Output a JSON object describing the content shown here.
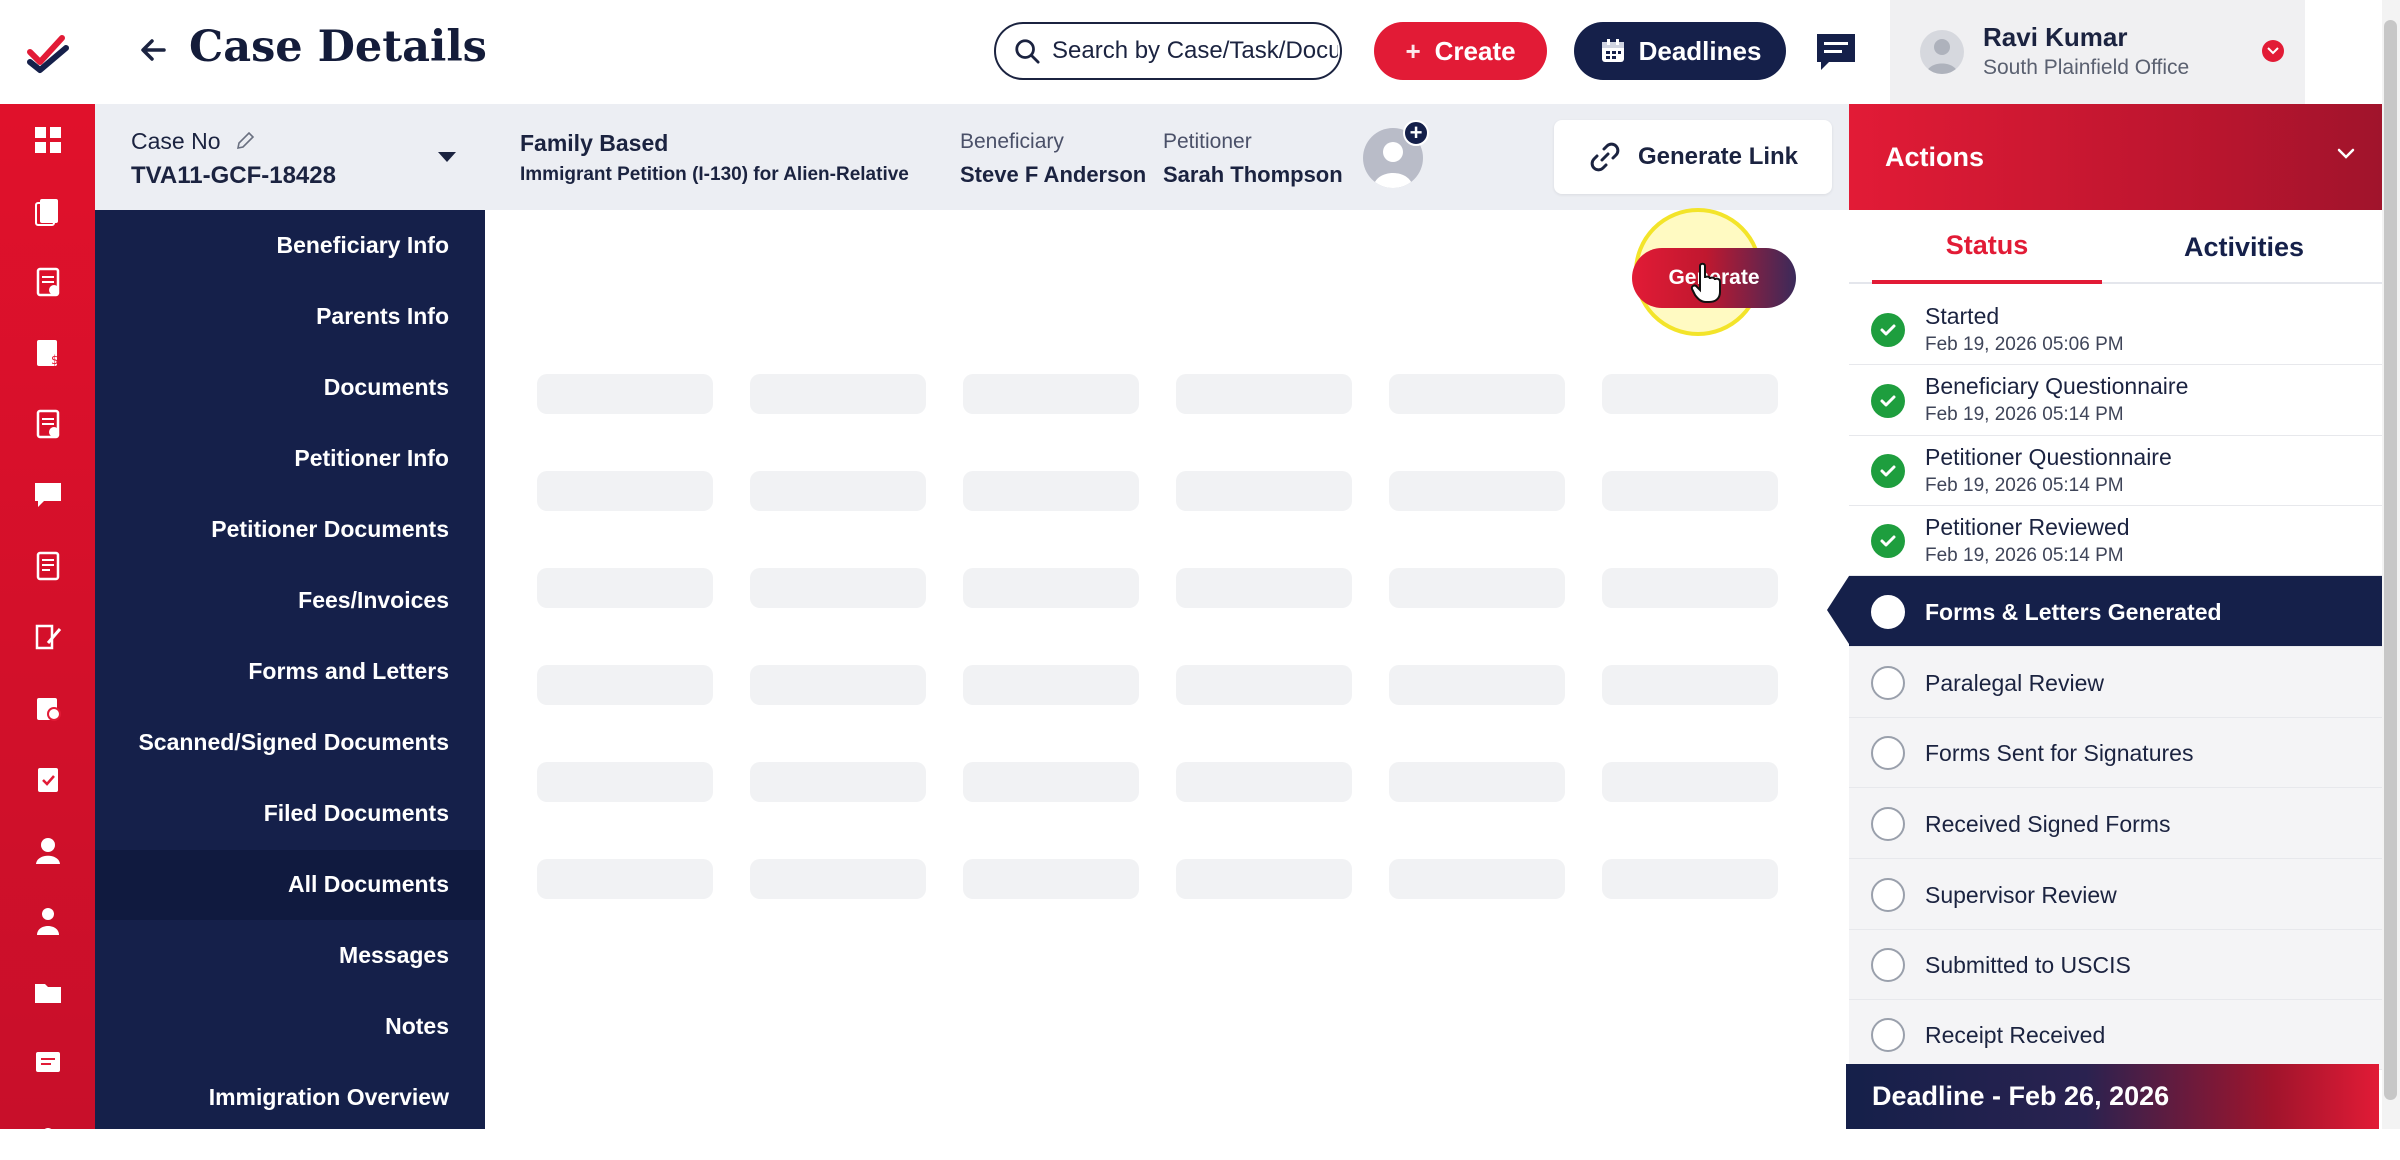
{
  "app": {
    "page_title": "Case Details",
    "brand_colors": {
      "primary_red": "#e21b36",
      "navy": "#15204a",
      "success_green": "#1e9e3e"
    }
  },
  "topbar": {
    "search_placeholder": "Search by Case/Task/Document",
    "create_label": "Create",
    "deadlines_label": "Deadlines",
    "user": {
      "name": "Ravi Kumar",
      "office": "South Plainfield Office"
    }
  },
  "rail": {
    "icons": [
      "dashboard-icon",
      "cases-icon",
      "forms-icon",
      "invoices-icon",
      "tasks-icon",
      "messages-icon",
      "documents-icon",
      "notes-icon",
      "reports-icon",
      "clipboard-icon",
      "user-icon",
      "contacts-icon",
      "folder-icon",
      "chat-icon",
      "more-icon"
    ]
  },
  "case": {
    "case_no_label": "Case No",
    "case_no": "TVA11-GCF-18428",
    "type": "Family Based",
    "subtype": "Immigrant Petition (I-130) for Alien-Relative",
    "beneficiary_label": "Beneficiary",
    "beneficiary": "Steve F Anderson",
    "petitioner_label": "Petitioner",
    "petitioner": "Sarah Thompson",
    "avatar_plus": "+",
    "generate_link_label": "Generate Link"
  },
  "nav": {
    "items": [
      "Beneficiary Info",
      "Parents Info",
      "Documents",
      "Petitioner Info",
      "Petitioner Documents",
      "Fees/Invoices",
      "Forms and Letters",
      "Scanned/Signed Documents",
      "Filed Documents",
      "All Documents",
      "Messages",
      "Notes",
      "Immigration Overview"
    ],
    "active": "Forms and Letters"
  },
  "main": {
    "generate_label": "Generate",
    "skeleton_rows": 6,
    "skeleton_cols": 6
  },
  "actions": {
    "title": "Actions",
    "tabs": {
      "status": "Status",
      "activities": "Activities"
    },
    "steps": [
      {
        "label": "Started",
        "date": "Feb 19, 2026 05:06 PM",
        "state": "done"
      },
      {
        "label": "Beneficiary Questionnaire",
        "date": "Feb 19, 2026 05:14 PM",
        "state": "done"
      },
      {
        "label": "Petitioner Questionnaire",
        "date": "Feb 19, 2026 05:14 PM",
        "state": "done"
      },
      {
        "label": "Petitioner Reviewed",
        "date": "Feb 19, 2026 05:14 PM",
        "state": "done"
      },
      {
        "label": "Forms & Letters Generated",
        "date": "",
        "state": "current"
      },
      {
        "label": "Paralegal Review",
        "date": "",
        "state": "pending"
      },
      {
        "label": "Forms Sent for Signatures",
        "date": "",
        "state": "pending"
      },
      {
        "label": "Received Signed Forms",
        "date": "",
        "state": "pending"
      },
      {
        "label": "Supervisor Review",
        "date": "",
        "state": "pending"
      },
      {
        "label": "Submitted to USCIS",
        "date": "",
        "state": "pending"
      },
      {
        "label": "Receipt Received",
        "date": "",
        "state": "pending"
      }
    ],
    "deadline": "Deadline - Feb 26, 2026"
  }
}
